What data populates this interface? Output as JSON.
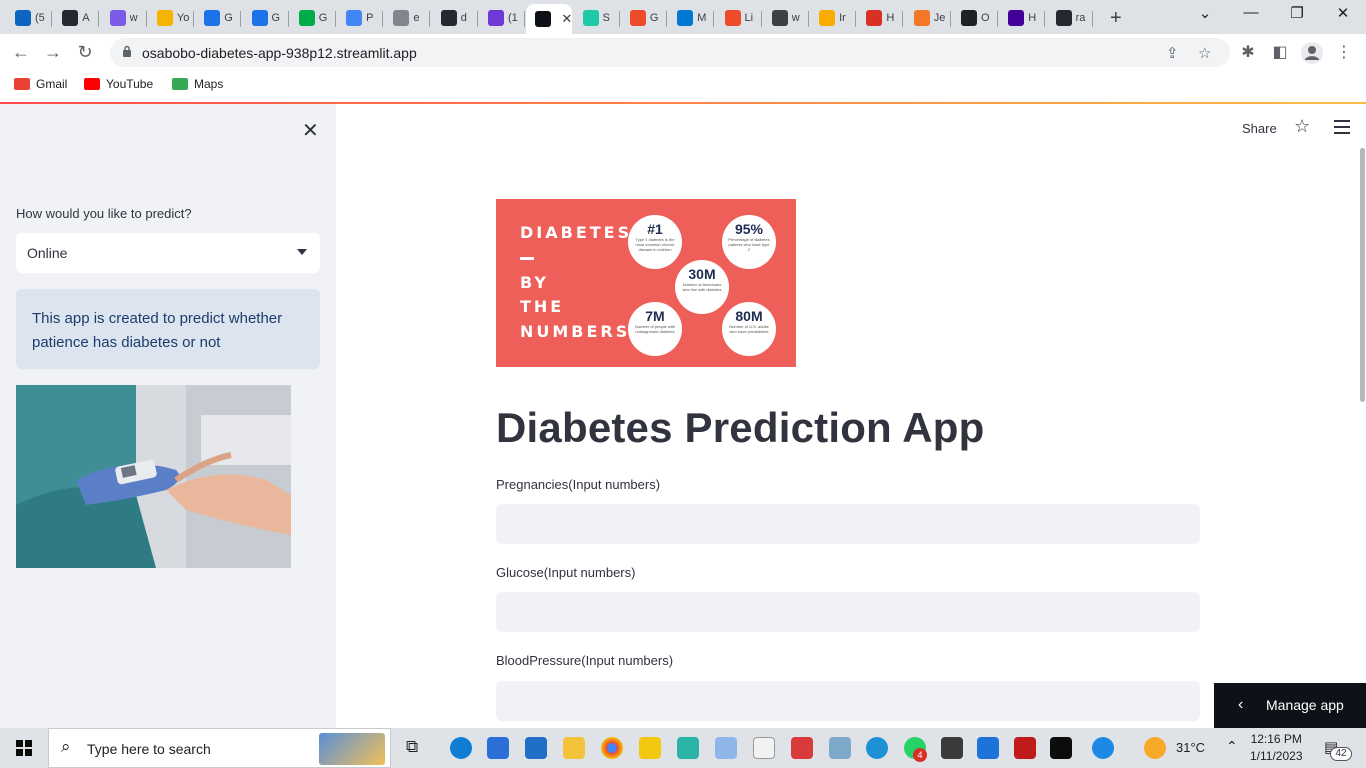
{
  "browser": {
    "tabs": [
      {
        "label": "(5",
        "icon": "linkedin-icon",
        "color": "#0a66c2"
      },
      {
        "label": "A",
        "icon": "github-icon",
        "color": "#24292f"
      },
      {
        "label": "w",
        "icon": "teams-icon",
        "color": "#7b5ae6"
      },
      {
        "label": "Yo",
        "icon": "drive-icon",
        "color": "#f4b400"
      },
      {
        "label": "G",
        "icon": "bot-icon",
        "color": "#1a73e8"
      },
      {
        "label": "G",
        "icon": "bot-icon",
        "color": "#1a73e8"
      },
      {
        "label": "G",
        "icon": "meet-icon",
        "color": "#00ac47"
      },
      {
        "label": "P",
        "icon": "docs-icon",
        "color": "#4285f4"
      },
      {
        "label": "e",
        "icon": "globe-icon",
        "color": "#80868b"
      },
      {
        "label": "d",
        "icon": "github-icon",
        "color": "#24292f"
      },
      {
        "label": "(1",
        "icon": "mail-icon",
        "color": "#6e3ad6"
      },
      {
        "label": "",
        "icon": "streamlit-icon",
        "color": "#0e1117",
        "active": true
      },
      {
        "label": "S",
        "icon": "stack-icon",
        "color": "#1ec9a6"
      },
      {
        "label": "G",
        "icon": "workflow-icon",
        "color": "#ee4b2b"
      },
      {
        "label": "M",
        "icon": "outlook-icon",
        "color": "#0078d4"
      },
      {
        "label": "Li",
        "icon": "workflow-icon",
        "color": "#ee4b2b"
      },
      {
        "label": "w",
        "icon": "openai-icon",
        "color": "#3c4043"
      },
      {
        "label": "Ir",
        "icon": "box-icon",
        "color": "#f9ab00"
      },
      {
        "label": "H",
        "icon": "heroku-icon",
        "color": "#d93025"
      },
      {
        "label": "Je",
        "icon": "jupyter-icon",
        "color": "#f37726"
      },
      {
        "label": "O",
        "icon": "chart-icon",
        "color": "#202124"
      },
      {
        "label": "H",
        "icon": "heroku-icon",
        "color": "#430098"
      },
      {
        "label": "ra",
        "icon": "github-icon",
        "color": "#24292f"
      }
    ],
    "url": "osabobo-diabetes-app-938p12.streamlit.app",
    "bookmarks": [
      {
        "label": "Gmail",
        "icon": "gmail-icon",
        "color": "#ea4335"
      },
      {
        "label": "YouTube",
        "icon": "youtube-icon",
        "color": "#ff0000"
      },
      {
        "label": "Maps",
        "icon": "maps-icon",
        "color": "#34a853"
      }
    ]
  },
  "sidebar": {
    "predict_label": "How would you like to predict?",
    "mode_value": "Online",
    "info_text": "This app is created to predict whether patience has diabetes or not"
  },
  "header": {
    "share_label": "Share"
  },
  "banner": {
    "line1": "DIABETES",
    "line2": "BY",
    "line3": "THE",
    "line4": "NUMBERS",
    "stats": [
      {
        "big": "#1",
        "small": "Type 1 diabetes is the most common chronic disease in children"
      },
      {
        "big": "95%",
        "small": "Percentage of diabetes patients who have type 2"
      },
      {
        "big": "30M",
        "small": "Number of Americans who live with diabetes"
      },
      {
        "big": "7M",
        "small": "Number of people with undiagnosed diabetes"
      },
      {
        "big": "80M",
        "small": "Number of U.S. adults who have prediabetes"
      }
    ]
  },
  "main": {
    "title": "Diabetes Prediction App",
    "fields": [
      {
        "label": "Pregnancies(Input numbers)",
        "value": ""
      },
      {
        "label": "Glucose(Input numbers)",
        "value": ""
      },
      {
        "label": "BloodPressure(Input numbers)",
        "value": ""
      }
    ],
    "manage_label": "Manage app"
  },
  "taskbar": {
    "search_placeholder": "Type here to search",
    "temperature": "31°C",
    "time": "12:16 PM",
    "date": "1/11/2023",
    "notifications": "42",
    "whatsapp_badge": "4"
  },
  "colors": {
    "sidebar_bg": "#f0f2f6",
    "info_bg": "#dce4ef",
    "info_text": "#1c3d6c",
    "banner_bg": "#ef5f59"
  }
}
